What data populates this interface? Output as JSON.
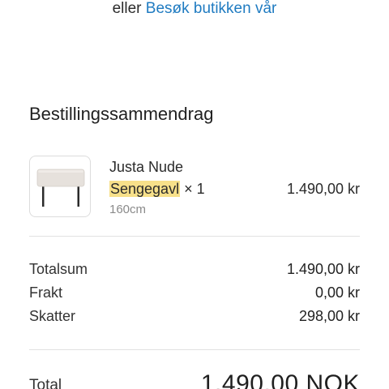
{
  "top": {
    "prefix": "eller",
    "link_label": "Besøk butikken vår",
    "link_color": "#1f7bc1"
  },
  "summary": {
    "title": "Bestillingssammendrag"
  },
  "product": {
    "name": "Justa Nude",
    "variant_highlighted": "Sengegavl",
    "quantity_text": "× 1",
    "size": "160cm",
    "price": "1.490,00 kr",
    "highlight_color": "#f7e08a"
  },
  "totals": {
    "rows": [
      {
        "label": "Totalsum",
        "value": "1.490,00 kr"
      },
      {
        "label": "Frakt",
        "value": "0,00 kr"
      },
      {
        "label": "Skatter",
        "value": "298,00 kr"
      }
    ],
    "total_label": "Total",
    "total_value": "1.490,00 NOK"
  }
}
